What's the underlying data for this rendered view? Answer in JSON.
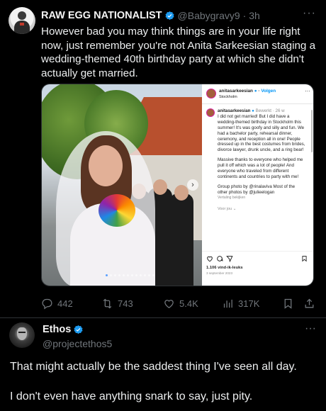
{
  "tweet1": {
    "author_name": "RAW EGG NATIONALIST",
    "handle": "@Babygravy9",
    "time": "· 3h",
    "more": "···",
    "text": "However bad you may think things are in your life right now, just remember you're not Anita Sarkeesian staging a wedding-themed 40th birthday party at which she didn't actually get married.",
    "actions": {
      "replies": "442",
      "reposts": "743",
      "likes": "5.4K",
      "views": "317K"
    },
    "embedded_post": {
      "username": "anitasarkeesian",
      "follow": "Volgen",
      "location": "Stockholm",
      "more": "···",
      "caption_user": "anitasarkeesian",
      "caption_meta": "Bewerkt · 26 w",
      "caption_p1": "I did not get married! But I did have a wedding-themed birthday in Stockholm this summer! It's was goofy and silly and fun. We had a bachelor party, rehearsal dinner, ceremony, and reception all in one! People dressed up in the best costumes from brides, divorce lawyer, drunk uncle, and a ring bear!",
      "caption_p2": "Massive thanks to everyone who helped me pull it off which was a lot of people! And everyone who traveled from different continents and countries to party with me!",
      "caption_p3": "Group photo by @rinalaviva Most of the other photos by @julieelogan",
      "caption_translate": "Vertaling bekijken",
      "caption_more": "Voor jou",
      "likes": "1.106 vind-ik-leuks",
      "date": "3 september 2023"
    }
  },
  "tweet2": {
    "author_name": "Ethos",
    "handle": "@projectethos5",
    "more": "···",
    "line1": "That might actually be the saddest thing I've seen all day.",
    "line2": "I don't even have anything snark to say, just pity."
  },
  "colors": {
    "background": "#000000",
    "text": "#e7e9ea",
    "muted": "#71767b",
    "verified": "#1d9bf0",
    "divider": "#2f3336"
  }
}
